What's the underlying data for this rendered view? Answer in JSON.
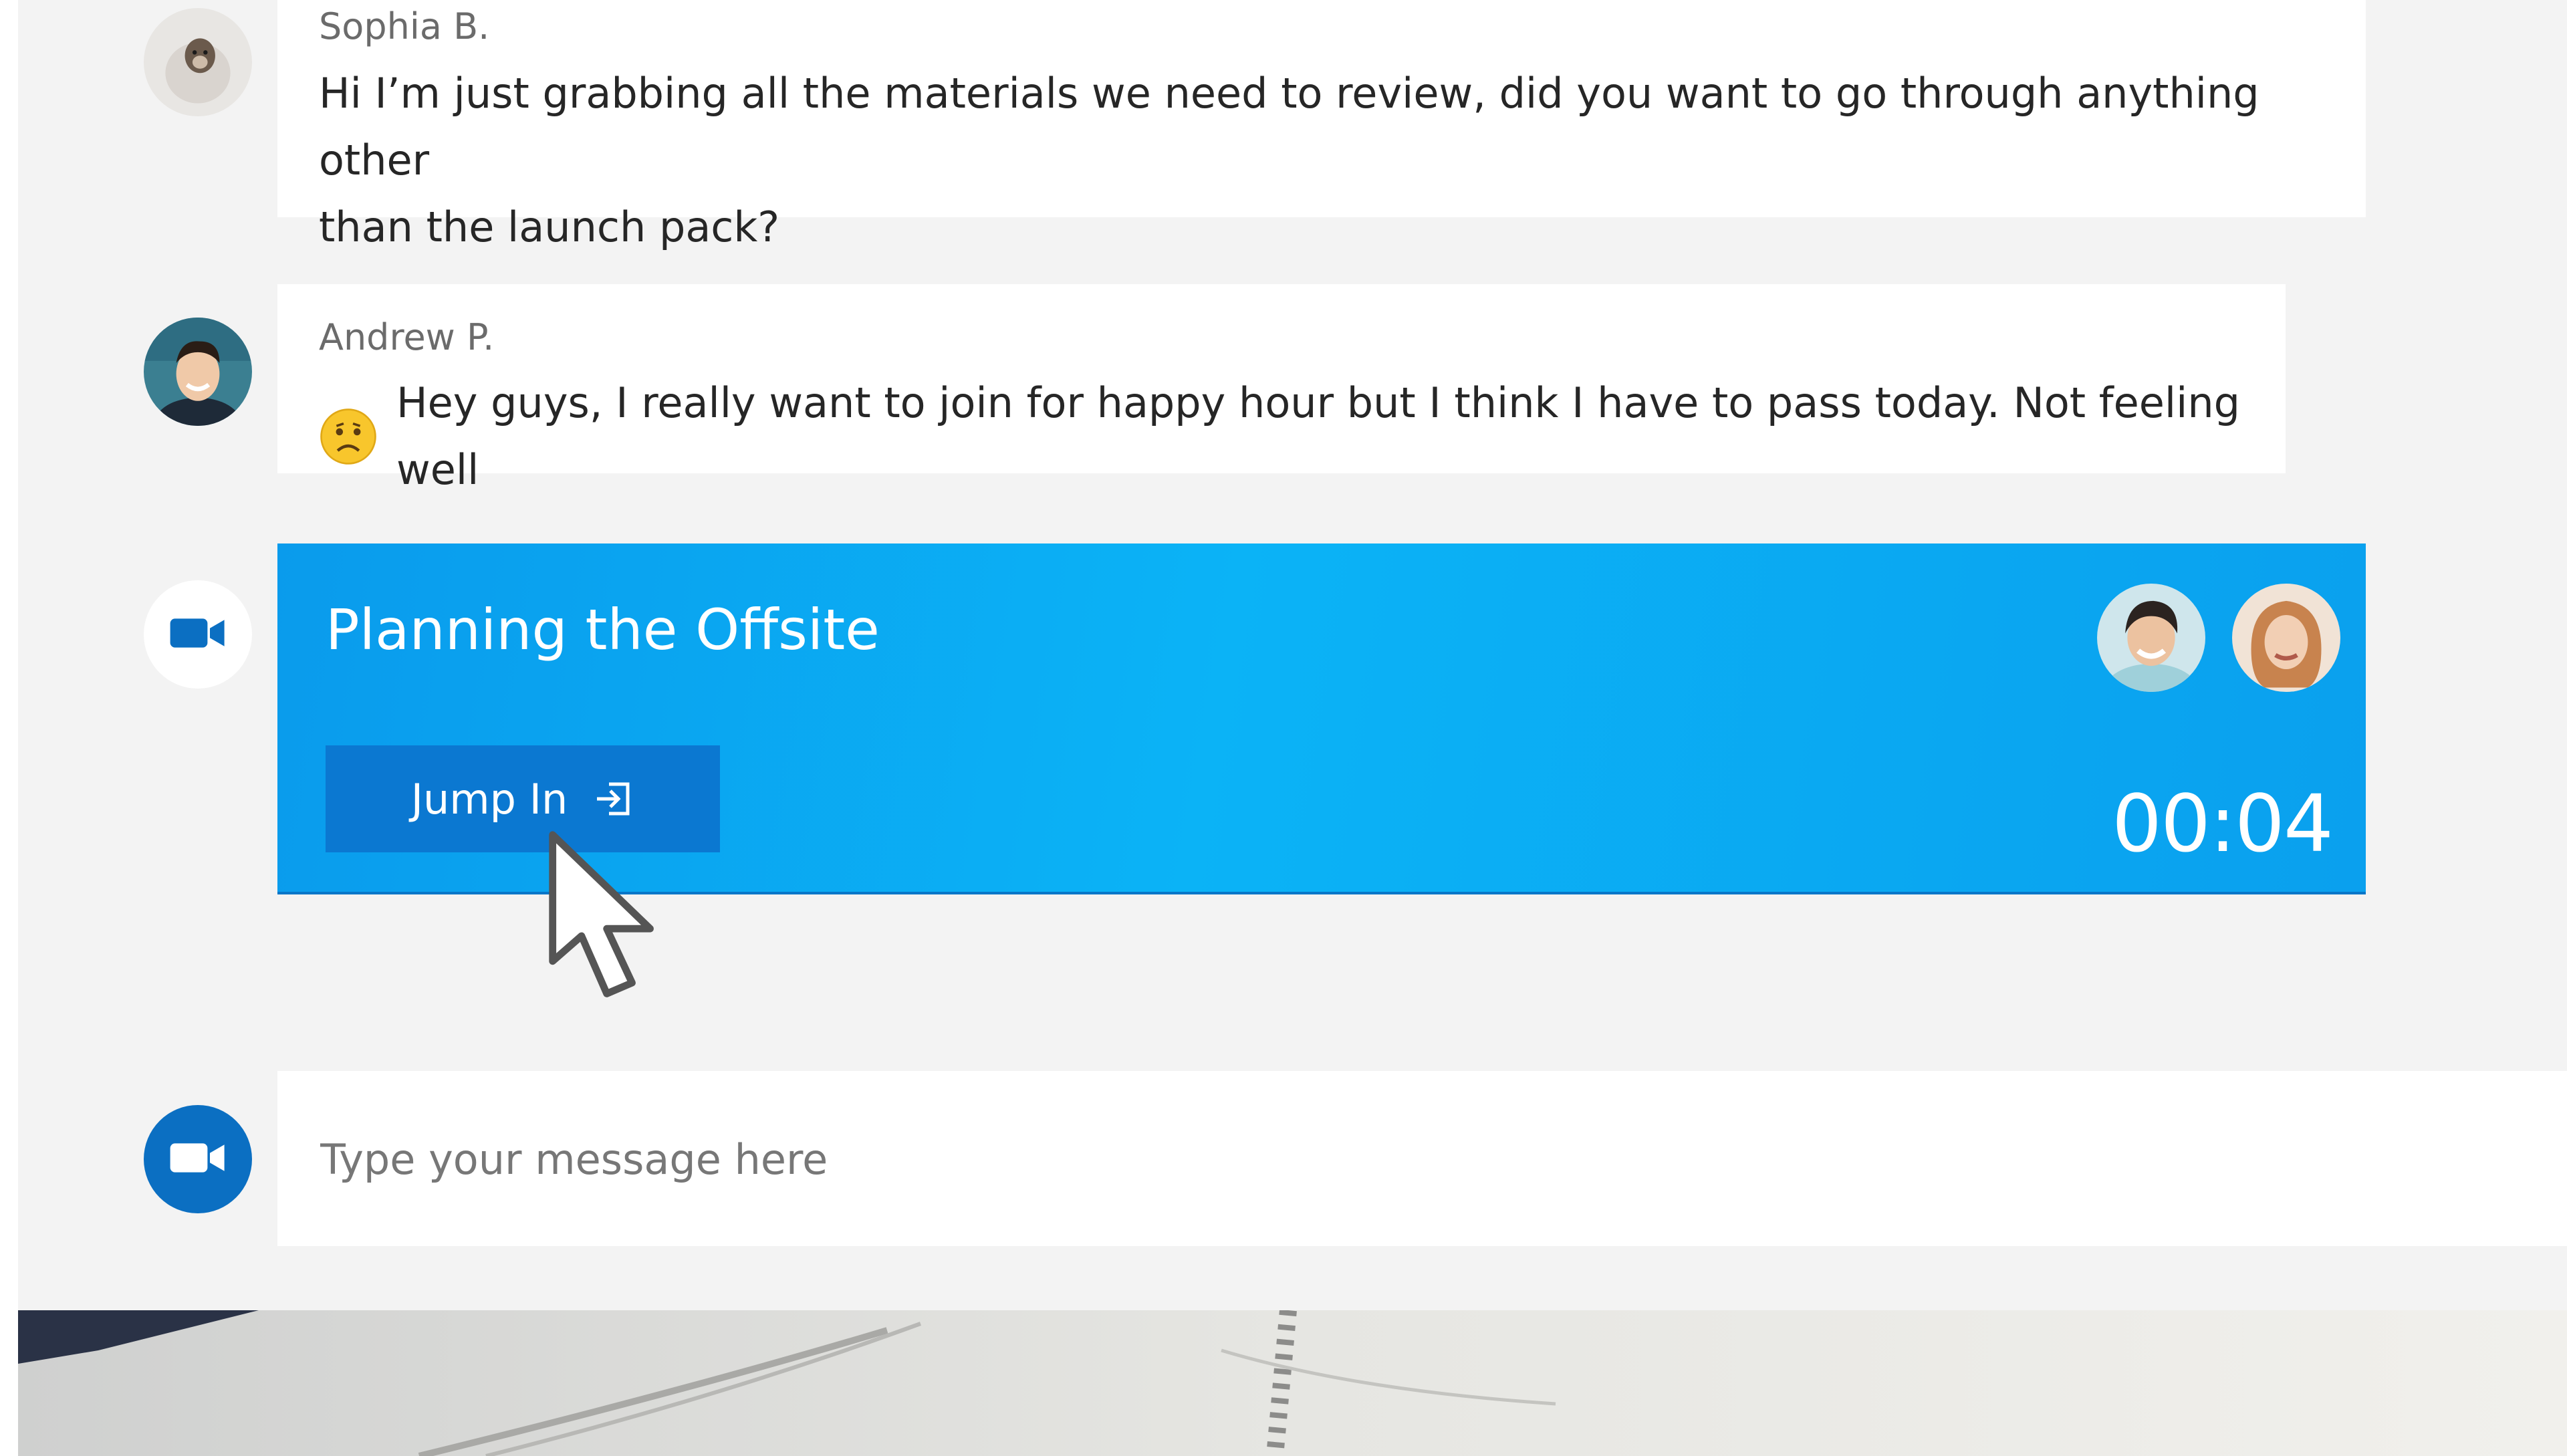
{
  "messages": [
    {
      "sender": "Sophia B.",
      "lines": [
        "Hi I’m just grabbing all the materials we need to review, did you want to go through anything other",
        "than the launch pack?"
      ]
    },
    {
      "sender": "Andrew P.",
      "emoji": "sad-face",
      "text": "Hey guys, I really want to join for happy hour but I think I have to pass today. Not feeling well"
    }
  ],
  "meeting": {
    "title": "Planning the Offsite",
    "join_label": "Jump In",
    "timer": "00:04",
    "participants": [
      "participant-1",
      "participant-2"
    ]
  },
  "composer": {
    "placeholder": "Type your message here"
  },
  "icons": {
    "meeting": "video-camera-icon",
    "composer": "video-camera-icon",
    "join": "enter-icon",
    "emoji": "sad-face-icon"
  },
  "colors": {
    "accent": "#0b78d1",
    "card": "#0bb3f6",
    "background": "#f3f3f3"
  }
}
